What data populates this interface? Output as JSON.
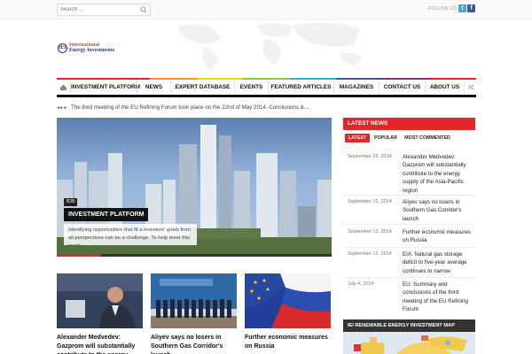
{
  "search": {
    "placeholder": "Search ..."
  },
  "social": {
    "follow_label": "FOLLOW US",
    "icons": [
      "twitter-icon",
      "facebook-icon"
    ]
  },
  "logo": {
    "badge": "IEI",
    "line1": "International",
    "line2": "Energy Investments"
  },
  "nav": {
    "items": [
      "INVESTMENT PLATFORM",
      "NEWS",
      "EXPERT DATABASE",
      "EVENTS",
      "FEATURED ARTICLES",
      "MAGAZINES",
      "CONTACT US",
      "ABOUT US"
    ],
    "stripe_colors": [
      "#e3262a",
      "#e3262a",
      "#f7941d",
      "#ffd200",
      "#8dc63f",
      "#2bb0e0",
      "#3b5a9a",
      "#92278f",
      "#e3262a"
    ]
  },
  "ticker": {
    "text": "The third meeting of the EU Refining Forum took place on the 22nd of May 2014. Conclusions &..."
  },
  "featured": {
    "date_badge": "B2B",
    "title": "INVESTMENT PLATFORM",
    "excerpt": "Identifying opportunities that fit a investors' goals from all perspectives can be a challenge. To help meet this need..."
  },
  "latest": {
    "title": "LATEST NEWS",
    "tabs": [
      "LATEST",
      "POPULAR",
      "MOST COMMENTED"
    ],
    "items": [
      {
        "date": "September 26, 2014",
        "text": "Alexander Medvedev: Gazprom will substantially contribute to the energy supply of the Asia-Pacific region"
      },
      {
        "date": "September 22, 2014",
        "text": "Aliyev says no losers in Southern Gas Corridor's launch"
      },
      {
        "date": "September 12, 2014",
        "text": "Further economic measures on Russia"
      },
      {
        "date": "September 12, 2014",
        "text": "EIA: Natural gas storage deficit to five-year average continues to narrow"
      },
      {
        "date": "July 4, 2014",
        "text": "EU: Summary and conclusions of the third meeting of the EU Refining Forum"
      }
    ]
  },
  "map": {
    "title": "IEI RENEWABLE ENERGY INVESTMENT MAP"
  },
  "thumbs": [
    {
      "title": "Alexander Medvedev: Gazprom will substantially contribute to the energy supply of the"
    },
    {
      "title": "Aliyev says no losers in Southern Gas Corridor's launch"
    },
    {
      "title": "Further economic measures on Russia"
    }
  ]
}
